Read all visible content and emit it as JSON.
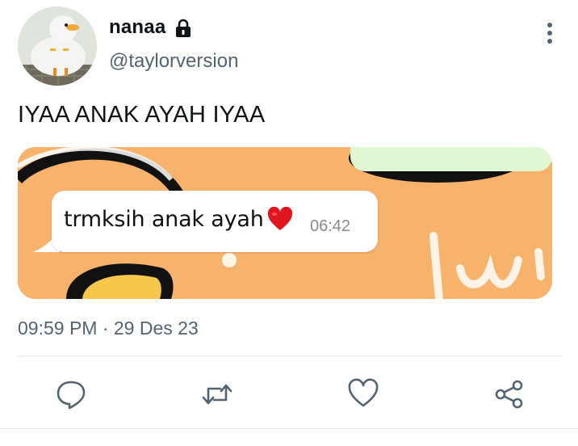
{
  "user": {
    "display_name": "nanaa",
    "handle": "@taylorversion",
    "protected": true,
    "avatar": "duck-photo"
  },
  "tweet": {
    "text": "IYAA ANAK AYAH IYAA",
    "timestamp": "09:59 PM · 29 Des 23"
  },
  "media": {
    "bubble_text": "trmksih anak ayah",
    "bubble_emoji": "heart-emoji",
    "bubble_time": "06:42",
    "background_color": "#f7b26c"
  },
  "actions": [
    {
      "name": "reply",
      "icon": "comment-icon"
    },
    {
      "name": "retweet",
      "icon": "retweet-icon"
    },
    {
      "name": "like",
      "icon": "heart-outline-icon"
    },
    {
      "name": "share",
      "icon": "share-icon"
    }
  ],
  "colors": {
    "text_primary": "#0f1419",
    "text_secondary": "#536471",
    "icon": "#536471"
  }
}
